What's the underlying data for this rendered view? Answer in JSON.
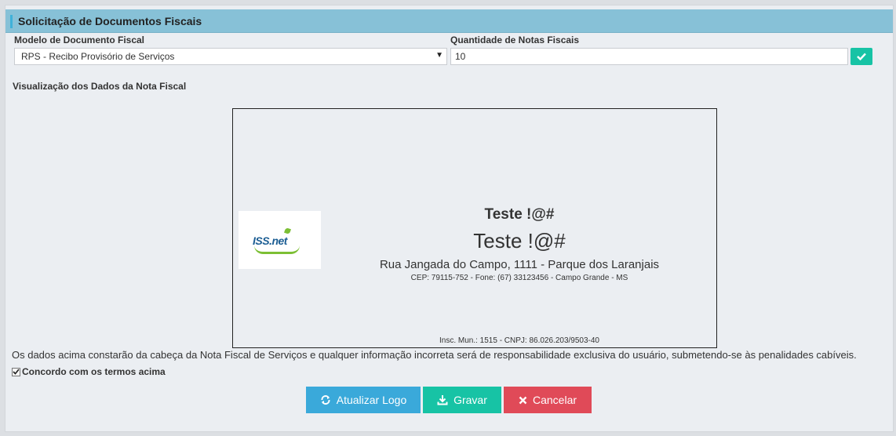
{
  "panel": {
    "title": "Solicitação de Documentos Fiscais"
  },
  "form": {
    "model_label": "Modelo de Documento Fiscal",
    "model_value": "RPS - Recibo Provisório de Serviços",
    "quantity_label": "Quantidade de Notas Fiscais",
    "quantity_value": "10"
  },
  "preview": {
    "section_label": "Visualização dos Dados da Nota Fiscal",
    "logo_text": "ISS.net",
    "title_bold": "Teste !@#",
    "title_large": "Teste !@#",
    "address": "Rua Jangada do Campo, 1111 - Parque dos Laranjais",
    "contact": "CEP: 79115-752 - Fone: (67) 33123456 - Campo Grande - MS",
    "registration": "Insc. Mun.: 1515 - CNPJ: 86.026.203/9503-40"
  },
  "disclaimer": "Os dados acima constarão da cabeça da Nota Fiscal de Serviços e qualquer informação incorreta será de responsabilidade exclusiva do usuário, submetendo-se às penalidades cabíveis.",
  "agree_label": "Concordo com os termos acima",
  "agree_checked": true,
  "buttons": {
    "update_logo": "Atualizar Logo",
    "save": "Gravar",
    "cancel": "Cancelar"
  },
  "colors": {
    "header": "#87c1d7",
    "primary": "#3aa9da",
    "success": "#17c3a5",
    "danger": "#e04a58"
  }
}
